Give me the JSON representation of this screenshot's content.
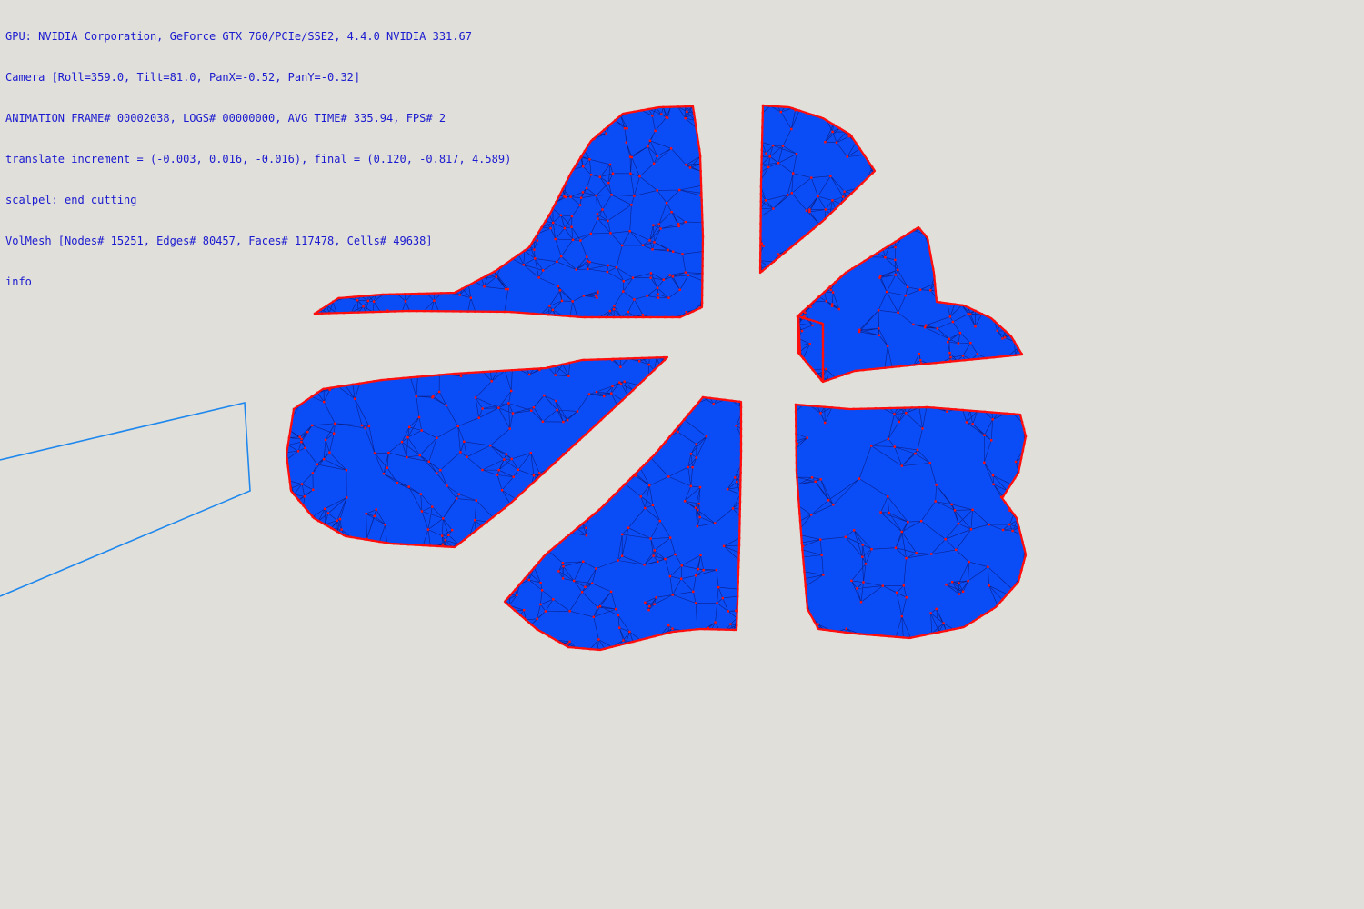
{
  "hud": {
    "gpu": "GPU: NVIDIA Corporation, GeForce GTX 760/PCIe/SSE2, 4.4.0 NVIDIA 331.67",
    "camera": "Camera [Roll=359.0, Tilt=81.0, PanX=-0.52, PanY=-0.32]",
    "animation": "ANIMATION FRAME# 00002038, LOGS# 00000000, AVG TIME# 335.94, FPS# 2",
    "translate": "translate increment = (-0.003, 0.016, -0.016), final = (0.120, -0.817, 4.589)",
    "scalpel": "scalpel: end cutting",
    "volmesh": "VolMesh [Nodes# 15251, Edges# 80457, Faces# 117478, Cells# 49638]",
    "info": "info"
  },
  "colors": {
    "background": "#e1dfd9",
    "hud_text": "#1a1ad0",
    "mesh_fill": "#0a4cf5",
    "mesh_nodes": "#ff0e0e",
    "mesh_wire": "#0b1a7a",
    "scalpel_outline": "#1e88ee"
  },
  "scene": {
    "mesh_fragment_count": 7,
    "tool": "scalpel"
  }
}
